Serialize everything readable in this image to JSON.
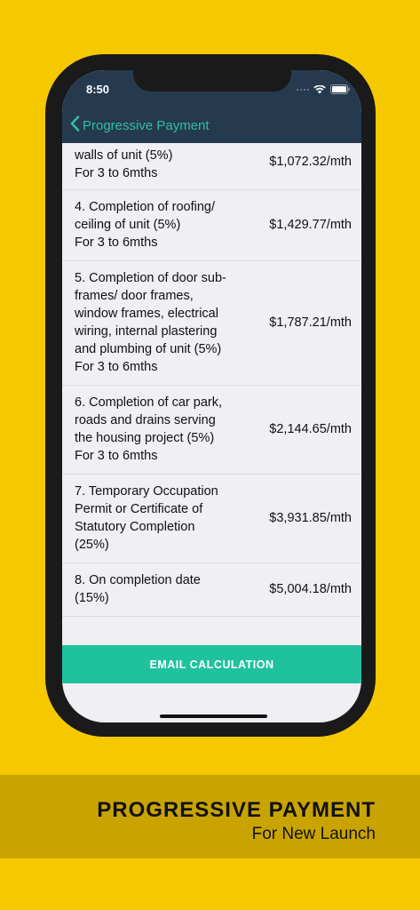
{
  "status_bar": {
    "time": "8:50"
  },
  "nav": {
    "back_label": "Progressive Payment"
  },
  "rows": [
    {
      "desc": "walls of unit (5%)\nFor 3 to 6mths",
      "amount": "$1,072.32/mth"
    },
    {
      "desc": "4. Completion of roofing/\nceiling of unit (5%)\nFor 3 to 6mths",
      "amount": "$1,429.77/mth"
    },
    {
      "desc": "5. Completion of door sub-\nframes/ door frames,\nwindow frames, electrical\nwiring, internal plastering\nand plumbing of unit (5%)\nFor 3 to 6mths",
      "amount": "$1,787.21/mth"
    },
    {
      "desc": "6. Completion of car park,\nroads and drains serving\nthe housing project (5%)\nFor 3 to 6mths",
      "amount": "$2,144.65/mth"
    },
    {
      "desc": "7. Temporary Occupation\nPermit or Certificate of\nStatutory Completion\n(25%)",
      "amount": "$3,931.85/mth"
    },
    {
      "desc": "8. On completion date\n(15%)",
      "amount": "$5,004.18/mth"
    }
  ],
  "email_button": "EMAIL CALCULATION",
  "banner": {
    "title": "PROGRESSIVE PAYMENT",
    "subtitle": "For New Launch"
  },
  "colors": {
    "background": "#f5c800",
    "nav": "#263a4f",
    "accent": "#20c29e"
  },
  "icons": {
    "back": "chevron-left-icon",
    "wifi": "wifi-icon",
    "battery": "battery-icon",
    "signal": "signal-icon"
  }
}
